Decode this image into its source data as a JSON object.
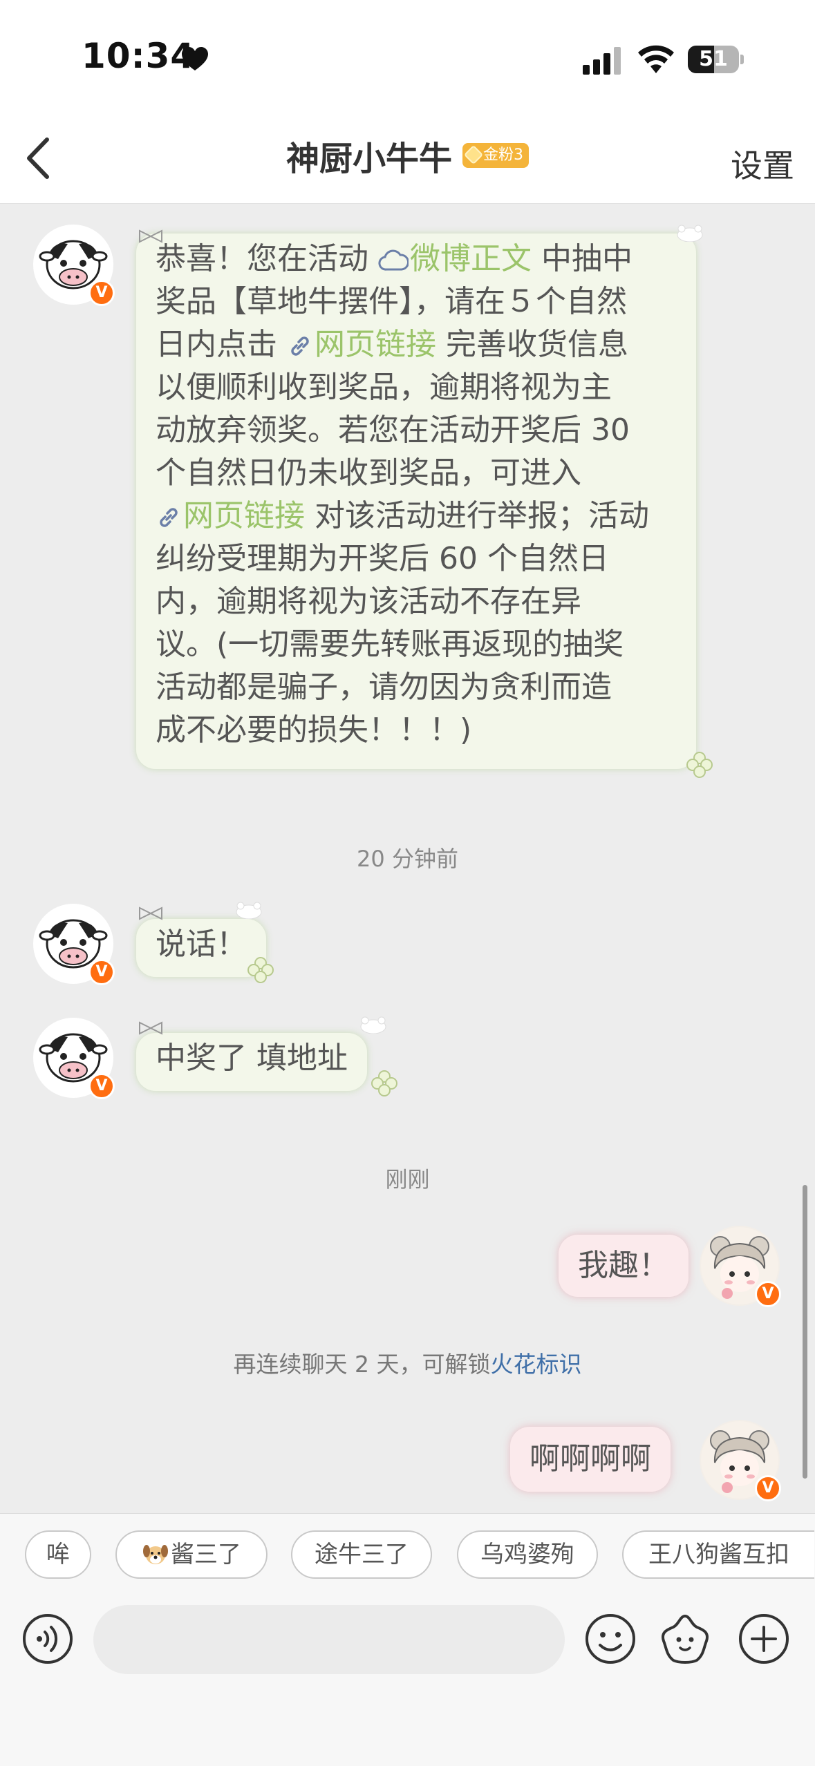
{
  "status_bar": {
    "time": "10:34",
    "battery": "51",
    "battery_level": 0.51
  },
  "nav": {
    "title": "神厨小牛牛",
    "fan_badge": "金粉3",
    "settings": "设置"
  },
  "messages": {
    "first": {
      "lines": [
        [
          "恭喜！您在活动 ",
          "微博正文",
          " 中抽中"
        ],
        [
          "奖品【草地牛摆件】，请在５个自然"
        ],
        [
          "日内点击 ",
          "网页链接",
          " 完善收货信息"
        ],
        [
          "以便顺利收到奖品，逾期将视为主"
        ],
        [
          "动放弃领奖。若您在活动开奖后 30"
        ],
        [
          "个自然日仍未收到奖品，可进入 "
        ],
        [
          "网页链接",
          " 对该活动进行举报；活动"
        ],
        [
          "纠纷受理期为开奖后 60 个自然日"
        ],
        [
          "内，逾期将视为该活动不存在异"
        ],
        [
          "议。(一切需要先转账再返现的抽奖"
        ],
        [
          "活动都是骗子，请勿因为贪利而造"
        ],
        [
          "成不必要的损失！！！)"
        ]
      ]
    },
    "time1": "20 分钟前",
    "second": "说话！",
    "third": "中奖了 填地址",
    "time2": "刚刚",
    "mine1": "我趣！",
    "system": {
      "prefix": "再连续聊天 2 天，可解锁",
      "accent": "火花标识"
    },
    "mine2": "啊啊啊啊"
  },
  "quick_replies": [
    "哞",
    "酱三了",
    "途牛三了",
    "乌鸡婆殉",
    "王八狗酱互扣"
  ],
  "badges": {
    "v": "V"
  },
  "colors": {
    "link": "#9bc46a",
    "accent": "#3f6fa8",
    "vip": "#ff6d10",
    "fan_badge": "#f4b43a"
  },
  "icons": [
    "heart-icon",
    "signal-icon",
    "wifi-icon",
    "battery-icon",
    "back-arrow-icon",
    "cloud-icon",
    "link-icon",
    "voice-icon",
    "emoji-icon",
    "sticker-icon",
    "plus-icon",
    "dog-face-icon"
  ]
}
